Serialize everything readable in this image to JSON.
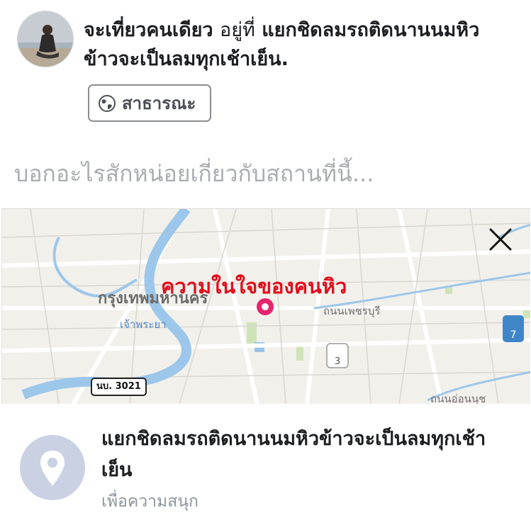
{
  "post": {
    "status_main": "จะเที่ยวคนเดียว",
    "status_at": "อยู่ที่",
    "status_location": "แยกชิดลมรถติดนานนมหิวข้าวจะเป็นลมทุกเช้าเย็น."
  },
  "privacy": {
    "label": "สาธารณะ",
    "icon": "globe-icon"
  },
  "composer": {
    "placeholder": "บอกอะไรสักหน่อยเกี่ยวกับสถานที่นี้..."
  },
  "map": {
    "caption": "ความในใจของคนหิว",
    "city_label": "กรุงเทพมหานคร",
    "river_label": "เจ้าพระยา",
    "road_label": "ถนนเพชรบุรี",
    "road_label_2": "ถนนอ่อนนุช",
    "route_badge": "นบ. 3021",
    "close_icon": "close-icon",
    "marker_color": "#e8246b"
  },
  "place": {
    "name": "แยกชิดลมรถติดนานนมหิวข้าวจะเป็นลมทุกเช้าเย็น",
    "category": "เพื่อความสนุก",
    "icon": "location-pin-icon"
  }
}
